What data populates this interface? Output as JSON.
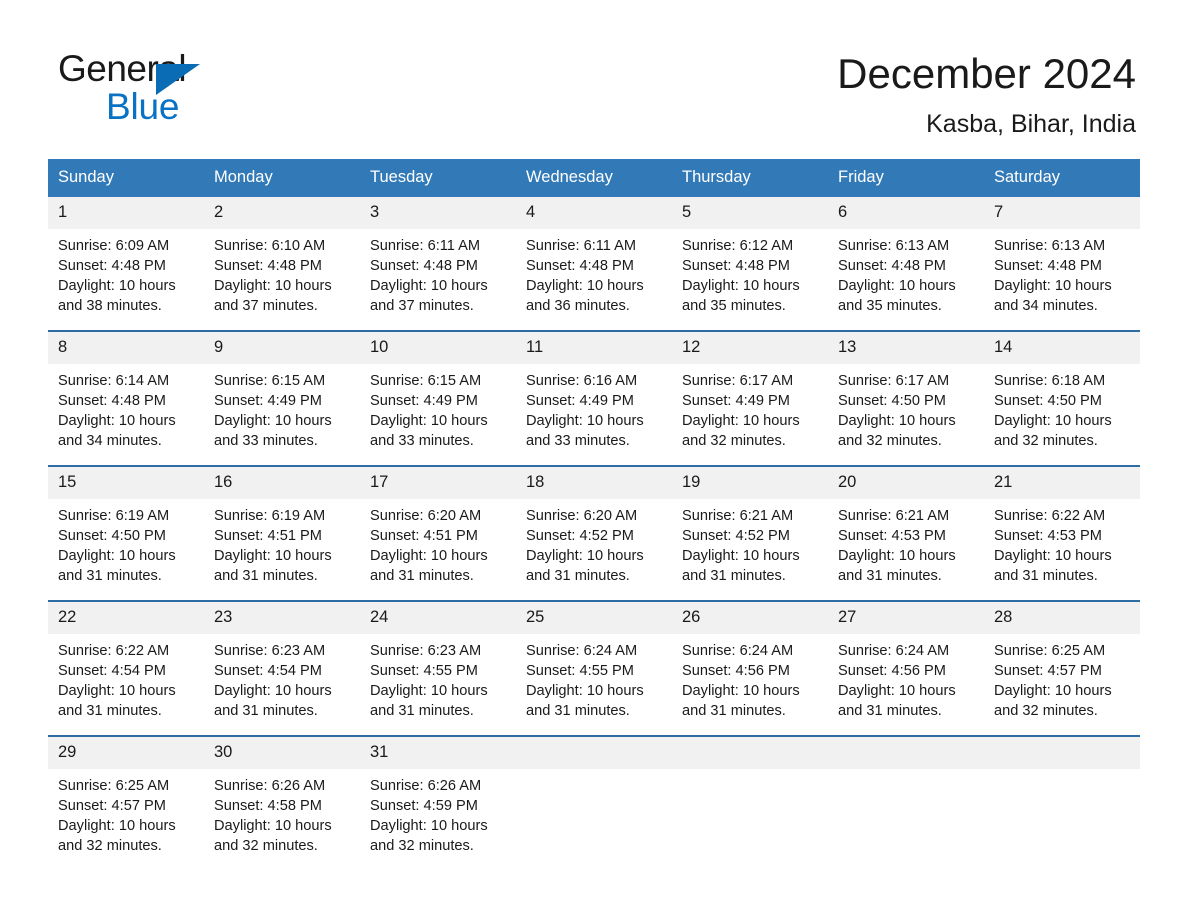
{
  "brand": {
    "name_top": "General",
    "name_bottom": "Blue",
    "accent_color": "#0a6cb4"
  },
  "header": {
    "title": "December 2024",
    "subtitle": "Kasba, Bihar, India"
  },
  "theme": {
    "header_blue": "#3279b8",
    "row_divider_blue": "#2e6da4",
    "daynum_band": "#f1f1f1",
    "text": "#1a1a1a"
  },
  "weekdays": [
    "Sunday",
    "Monday",
    "Tuesday",
    "Wednesday",
    "Thursday",
    "Friday",
    "Saturday"
  ],
  "weeks": [
    [
      {
        "day": "1",
        "sunrise": "Sunrise: 6:09 AM",
        "sunset": "Sunset: 4:48 PM",
        "daylight_1": "Daylight: 10 hours",
        "daylight_2": "and 38 minutes."
      },
      {
        "day": "2",
        "sunrise": "Sunrise: 6:10 AM",
        "sunset": "Sunset: 4:48 PM",
        "daylight_1": "Daylight: 10 hours",
        "daylight_2": "and 37 minutes."
      },
      {
        "day": "3",
        "sunrise": "Sunrise: 6:11 AM",
        "sunset": "Sunset: 4:48 PM",
        "daylight_1": "Daylight: 10 hours",
        "daylight_2": "and 37 minutes."
      },
      {
        "day": "4",
        "sunrise": "Sunrise: 6:11 AM",
        "sunset": "Sunset: 4:48 PM",
        "daylight_1": "Daylight: 10 hours",
        "daylight_2": "and 36 minutes."
      },
      {
        "day": "5",
        "sunrise": "Sunrise: 6:12 AM",
        "sunset": "Sunset: 4:48 PM",
        "daylight_1": "Daylight: 10 hours",
        "daylight_2": "and 35 minutes."
      },
      {
        "day": "6",
        "sunrise": "Sunrise: 6:13 AM",
        "sunset": "Sunset: 4:48 PM",
        "daylight_1": "Daylight: 10 hours",
        "daylight_2": "and 35 minutes."
      },
      {
        "day": "7",
        "sunrise": "Sunrise: 6:13 AM",
        "sunset": "Sunset: 4:48 PM",
        "daylight_1": "Daylight: 10 hours",
        "daylight_2": "and 34 minutes."
      }
    ],
    [
      {
        "day": "8",
        "sunrise": "Sunrise: 6:14 AM",
        "sunset": "Sunset: 4:48 PM",
        "daylight_1": "Daylight: 10 hours",
        "daylight_2": "and 34 minutes."
      },
      {
        "day": "9",
        "sunrise": "Sunrise: 6:15 AM",
        "sunset": "Sunset: 4:49 PM",
        "daylight_1": "Daylight: 10 hours",
        "daylight_2": "and 33 minutes."
      },
      {
        "day": "10",
        "sunrise": "Sunrise: 6:15 AM",
        "sunset": "Sunset: 4:49 PM",
        "daylight_1": "Daylight: 10 hours",
        "daylight_2": "and 33 minutes."
      },
      {
        "day": "11",
        "sunrise": "Sunrise: 6:16 AM",
        "sunset": "Sunset: 4:49 PM",
        "daylight_1": "Daylight: 10 hours",
        "daylight_2": "and 33 minutes."
      },
      {
        "day": "12",
        "sunrise": "Sunrise: 6:17 AM",
        "sunset": "Sunset: 4:49 PM",
        "daylight_1": "Daylight: 10 hours",
        "daylight_2": "and 32 minutes."
      },
      {
        "day": "13",
        "sunrise": "Sunrise: 6:17 AM",
        "sunset": "Sunset: 4:50 PM",
        "daylight_1": "Daylight: 10 hours",
        "daylight_2": "and 32 minutes."
      },
      {
        "day": "14",
        "sunrise": "Sunrise: 6:18 AM",
        "sunset": "Sunset: 4:50 PM",
        "daylight_1": "Daylight: 10 hours",
        "daylight_2": "and 32 minutes."
      }
    ],
    [
      {
        "day": "15",
        "sunrise": "Sunrise: 6:19 AM",
        "sunset": "Sunset: 4:50 PM",
        "daylight_1": "Daylight: 10 hours",
        "daylight_2": "and 31 minutes."
      },
      {
        "day": "16",
        "sunrise": "Sunrise: 6:19 AM",
        "sunset": "Sunset: 4:51 PM",
        "daylight_1": "Daylight: 10 hours",
        "daylight_2": "and 31 minutes."
      },
      {
        "day": "17",
        "sunrise": "Sunrise: 6:20 AM",
        "sunset": "Sunset: 4:51 PM",
        "daylight_1": "Daylight: 10 hours",
        "daylight_2": "and 31 minutes."
      },
      {
        "day": "18",
        "sunrise": "Sunrise: 6:20 AM",
        "sunset": "Sunset: 4:52 PM",
        "daylight_1": "Daylight: 10 hours",
        "daylight_2": "and 31 minutes."
      },
      {
        "day": "19",
        "sunrise": "Sunrise: 6:21 AM",
        "sunset": "Sunset: 4:52 PM",
        "daylight_1": "Daylight: 10 hours",
        "daylight_2": "and 31 minutes."
      },
      {
        "day": "20",
        "sunrise": "Sunrise: 6:21 AM",
        "sunset": "Sunset: 4:53 PM",
        "daylight_1": "Daylight: 10 hours",
        "daylight_2": "and 31 minutes."
      },
      {
        "day": "21",
        "sunrise": "Sunrise: 6:22 AM",
        "sunset": "Sunset: 4:53 PM",
        "daylight_1": "Daylight: 10 hours",
        "daylight_2": "and 31 minutes."
      }
    ],
    [
      {
        "day": "22",
        "sunrise": "Sunrise: 6:22 AM",
        "sunset": "Sunset: 4:54 PM",
        "daylight_1": "Daylight: 10 hours",
        "daylight_2": "and 31 minutes."
      },
      {
        "day": "23",
        "sunrise": "Sunrise: 6:23 AM",
        "sunset": "Sunset: 4:54 PM",
        "daylight_1": "Daylight: 10 hours",
        "daylight_2": "and 31 minutes."
      },
      {
        "day": "24",
        "sunrise": "Sunrise: 6:23 AM",
        "sunset": "Sunset: 4:55 PM",
        "daylight_1": "Daylight: 10 hours",
        "daylight_2": "and 31 minutes."
      },
      {
        "day": "25",
        "sunrise": "Sunrise: 6:24 AM",
        "sunset": "Sunset: 4:55 PM",
        "daylight_1": "Daylight: 10 hours",
        "daylight_2": "and 31 minutes."
      },
      {
        "day": "26",
        "sunrise": "Sunrise: 6:24 AM",
        "sunset": "Sunset: 4:56 PM",
        "daylight_1": "Daylight: 10 hours",
        "daylight_2": "and 31 minutes."
      },
      {
        "day": "27",
        "sunrise": "Sunrise: 6:24 AM",
        "sunset": "Sunset: 4:56 PM",
        "daylight_1": "Daylight: 10 hours",
        "daylight_2": "and 31 minutes."
      },
      {
        "day": "28",
        "sunrise": "Sunrise: 6:25 AM",
        "sunset": "Sunset: 4:57 PM",
        "daylight_1": "Daylight: 10 hours",
        "daylight_2": "and 32 minutes."
      }
    ],
    [
      {
        "day": "29",
        "sunrise": "Sunrise: 6:25 AM",
        "sunset": "Sunset: 4:57 PM",
        "daylight_1": "Daylight: 10 hours",
        "daylight_2": "and 32 minutes."
      },
      {
        "day": "30",
        "sunrise": "Sunrise: 6:26 AM",
        "sunset": "Sunset: 4:58 PM",
        "daylight_1": "Daylight: 10 hours",
        "daylight_2": "and 32 minutes."
      },
      {
        "day": "31",
        "sunrise": "Sunrise: 6:26 AM",
        "sunset": "Sunset: 4:59 PM",
        "daylight_1": "Daylight: 10 hours",
        "daylight_2": "and 32 minutes."
      },
      {
        "day": "",
        "sunrise": "",
        "sunset": "",
        "daylight_1": "",
        "daylight_2": ""
      },
      {
        "day": "",
        "sunrise": "",
        "sunset": "",
        "daylight_1": "",
        "daylight_2": ""
      },
      {
        "day": "",
        "sunrise": "",
        "sunset": "",
        "daylight_1": "",
        "daylight_2": ""
      },
      {
        "day": "",
        "sunrise": "",
        "sunset": "",
        "daylight_1": "",
        "daylight_2": ""
      }
    ]
  ]
}
